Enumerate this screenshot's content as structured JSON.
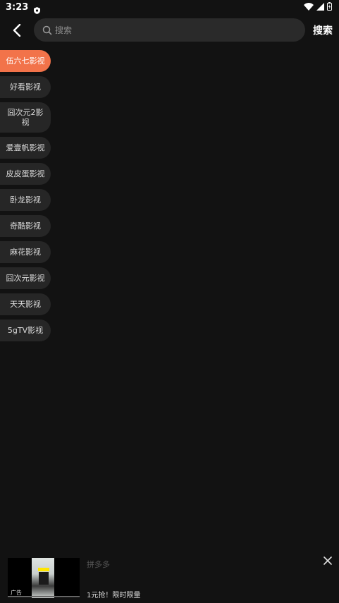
{
  "status_bar": {
    "time": "3:23"
  },
  "header": {
    "search_placeholder": "搜索",
    "search_button": "搜索"
  },
  "sources": [
    {
      "label": "伍六七影视",
      "active": true
    },
    {
      "label": "好看影视"
    },
    {
      "label": "囧次元2影视"
    },
    {
      "label": "爱壹帆影视"
    },
    {
      "label": "皮皮蛋影视"
    },
    {
      "label": "卧龙影视"
    },
    {
      "label": "奇酷影视"
    },
    {
      "label": "麻花影视"
    },
    {
      "label": "囧次元影视"
    },
    {
      "label": "天天影视"
    },
    {
      "label": "5gTV影视"
    }
  ],
  "ad": {
    "badge": "广告",
    "title": "拼多多",
    "description": "1元抢！限时限量"
  },
  "colors": {
    "accent": "#f2734a",
    "background": "#121212",
    "chip": "#262626"
  }
}
